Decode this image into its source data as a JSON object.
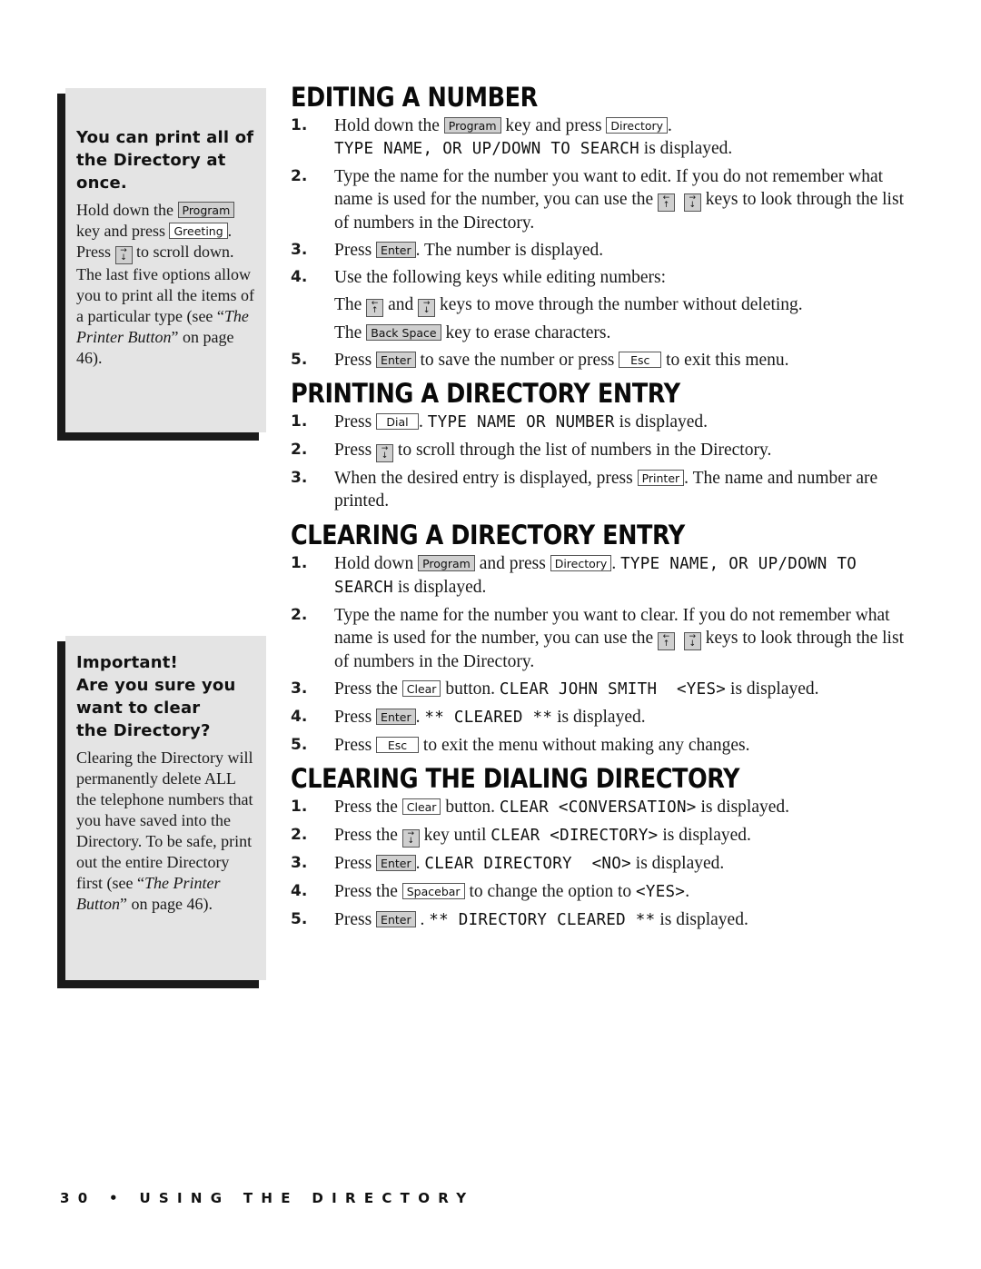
{
  "sidebar": {
    "tip": {
      "heading": [
        "You can print all of",
        "the Directory at",
        "once."
      ],
      "body": {
        "t1": "Hold down the ",
        "key1": "Program",
        "t2": " key and press ",
        "key2": "Greeting",
        "t3": ". Press ",
        "t4": " to scroll down. The last five options allow you to print all the items of a particular type (see “",
        "ref": "The Printer Button",
        "t5": "” on page 46)."
      }
    },
    "warning": {
      "heading": [
        "Important!",
        "Are you sure you",
        "want to clear",
        "the Directory?"
      ],
      "body": {
        "t1": "Clearing the Directory will permanently delete ALL the telephone numbers that you have saved into the Directory. To be safe, print out the entire Directory first (see “",
        "ref": "The Printer Button",
        "t2": "” on page 46)."
      }
    }
  },
  "sections": {
    "editing": {
      "title": "EDITING A NUMBER",
      "steps": {
        "s1": {
          "num": "1.",
          "t1": "Hold down the ",
          "key1": "Program",
          "t2": " key and press ",
          "key2": "Directory",
          "t3": ".",
          "lcd": "TYPE NAME, OR UP/DOWN TO SEARCH",
          "t4": " is displayed."
        },
        "s2": {
          "num": "2.",
          "t1": "Type the name for the number you want to edit. If you do not remember what name is used for the number, you can use the ",
          "t2": " keys to look through the list of numbers in the Directory."
        },
        "s3": {
          "num": "3.",
          "t1": "Press ",
          "key1": "Enter",
          "t2": ". The number is displayed."
        },
        "s4": {
          "num": "4.",
          "t1": "Use the following keys while editing numbers:",
          "l1a": "The ",
          "l1b": " and ",
          "l1c": " keys to move through the number without deleting.",
          "l2a": "The ",
          "key1": "Back Space",
          "l2b": " key to erase characters."
        },
        "s5": {
          "num": "5.",
          "t1": "Press ",
          "key1": "Enter",
          "t2": " to save the number or press ",
          "key2": "Esc",
          "t3": " to exit this menu."
        }
      }
    },
    "printing": {
      "title": "PRINTING A DIRECTORY ENTRY",
      "steps": {
        "s1": {
          "num": "1.",
          "t1": "Press ",
          "key1": "Dial",
          "t2": ". ",
          "lcd": "TYPE NAME OR NUMBER",
          "t3": " is displayed."
        },
        "s2": {
          "num": "2.",
          "t1": "Press ",
          "t2": " to scroll through the list of numbers in the Directory."
        },
        "s3": {
          "num": "3.",
          "t1": "When the desired entry is displayed, press ",
          "key1": "Printer",
          "t2": ". The name and number are printed."
        }
      }
    },
    "clearing_entry": {
      "title": "CLEARING A DIRECTORY ENTRY",
      "steps": {
        "s1": {
          "num": "1.",
          "t1": "Hold down ",
          "key1": "Program",
          "t2": " and press ",
          "key2": "Directory",
          "t3": ". ",
          "lcd": "TYPE NAME, OR UP/DOWN TO SEARCH",
          "t4": " is displayed."
        },
        "s2": {
          "num": "2.",
          "t1": "Type the name for the number you want to clear. If you do not remember what name is used for the number, you can use the ",
          "t2": " keys to look through the list of numbers in the Directory."
        },
        "s3": {
          "num": "3.",
          "t1": "Press the ",
          "key1": "Clear",
          "t2": " button. ",
          "lcd": "CLEAR JOHN SMITH  <YES>",
          "t3": " is displayed."
        },
        "s4": {
          "num": "4.",
          "t1": "Press ",
          "key1": "Enter",
          "t2": ". ",
          "lcd": "** CLEARED **",
          "t3": " is displayed."
        },
        "s5": {
          "num": "5.",
          "t1": "Press ",
          "key1": "Esc",
          "t2": " to exit the menu without making any changes."
        }
      }
    },
    "clearing_directory": {
      "title": "CLEARING THE DIALING DIRECTORY",
      "steps": {
        "s1": {
          "num": "1.",
          "t1": "Press the ",
          "key1": "Clear",
          "t2": " button. ",
          "lcd": "CLEAR <CONVERSATION>",
          "t3": " is displayed."
        },
        "s2": {
          "num": "2.",
          "t1": "Press the ",
          "t2": " key until ",
          "lcd": "CLEAR <DIRECTORY>",
          "t3": " is displayed."
        },
        "s3": {
          "num": "3.",
          "t1": "Press ",
          "key1": "Enter",
          "t2": ". ",
          "lcd": "CLEAR DIRECTORY  <NO>",
          "t3": " is displayed."
        },
        "s4": {
          "num": "4.",
          "t1": "Press the ",
          "key1": "Spacebar",
          "t2": " to change the option to ",
          "lcd": "<YES>",
          "t3": "."
        },
        "s5": {
          "num": "5.",
          "t1": "Press ",
          "key1": "Enter",
          "t2": " . ",
          "lcd": "** DIRECTORY CLEARED **",
          "t3": " is displayed."
        }
      }
    }
  },
  "keys": {
    "up_left": {
      "top": "←",
      "bottom": "↑"
    },
    "down_right": {
      "top": "→",
      "bottom": "↓"
    }
  },
  "footer": {
    "page_number": "30",
    "separator": "•",
    "chapter": "USING THE DIRECTORY"
  }
}
